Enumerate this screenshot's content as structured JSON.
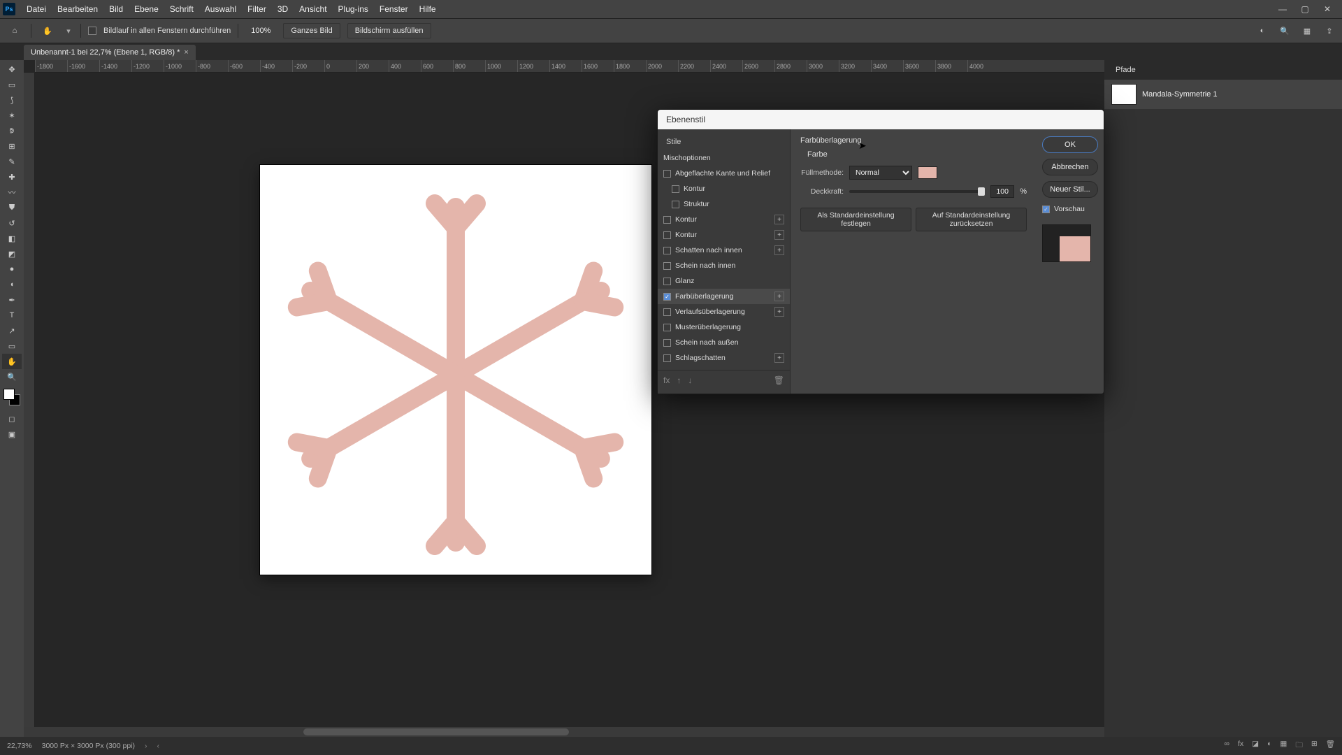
{
  "menu": {
    "items": [
      "Datei",
      "Bearbeiten",
      "Bild",
      "Ebene",
      "Schrift",
      "Auswahl",
      "Filter",
      "3D",
      "Ansicht",
      "Plug-ins",
      "Fenster",
      "Hilfe"
    ]
  },
  "opt": {
    "scrollcheck": "Bildlauf in allen Fenstern durchführen",
    "zoom": "100%",
    "fit": "Ganzes Bild",
    "fill": "Bildschirm ausfüllen"
  },
  "doc": {
    "tab": "Unbenannt-1 bei 22,7% (Ebene 1, RGB/8) *"
  },
  "ruler": {
    "marks": [
      "-1800",
      "-1600",
      "-1400",
      "-1200",
      "-1000",
      "-800",
      "-600",
      "-400",
      "-200",
      "0",
      "200",
      "400",
      "600",
      "800",
      "1000",
      "1200",
      "1400",
      "1600",
      "1800",
      "2000",
      "2200",
      "2400",
      "2600",
      "2800",
      "3000",
      "3200",
      "3400",
      "3600",
      "3800",
      "4000"
    ]
  },
  "paths": {
    "tab": "Pfade",
    "item": "Mandala-Symmetrie 1"
  },
  "dialog": {
    "title": "Ebenenstil",
    "stile": "Stile",
    "misch": "Mischoptionen",
    "effects": [
      {
        "label": "Abgeflachte Kante und Relief",
        "plus": false,
        "on": false,
        "sub": false
      },
      {
        "label": "Kontur",
        "plus": false,
        "on": false,
        "sub": true
      },
      {
        "label": "Struktur",
        "plus": false,
        "on": false,
        "sub": true
      },
      {
        "label": "Kontur",
        "plus": true,
        "on": false,
        "sub": false
      },
      {
        "label": "Kontur",
        "plus": true,
        "on": false,
        "sub": false
      },
      {
        "label": "Schatten nach innen",
        "plus": true,
        "on": false,
        "sub": false
      },
      {
        "label": "Schein nach innen",
        "plus": false,
        "on": false,
        "sub": false
      },
      {
        "label": "Glanz",
        "plus": false,
        "on": false,
        "sub": false
      },
      {
        "label": "Farbüberlagerung",
        "plus": true,
        "on": true,
        "sub": false,
        "sel": true
      },
      {
        "label": "Verlaufsüberlagerung",
        "plus": true,
        "on": false,
        "sub": false
      },
      {
        "label": "Musterüberlagerung",
        "plus": false,
        "on": false,
        "sub": false
      },
      {
        "label": "Schein nach außen",
        "plus": false,
        "on": false,
        "sub": false
      },
      {
        "label": "Schlagschatten",
        "plus": true,
        "on": false,
        "sub": false
      }
    ],
    "panel": {
      "heading": "Farbüberlagerung",
      "sub": "Farbe",
      "blend_lbl": "Füllmethode:",
      "blend_val": "Normal",
      "opac_lbl": "Deckkraft:",
      "opac_val": "100",
      "opac_unit": "%",
      "defbtn1": "Als Standardeinstellung festlegen",
      "defbtn2": "Auf Standardeinstellung zurücksetzen"
    },
    "btns": {
      "ok": "OK",
      "cancel": "Abbrechen",
      "new": "Neuer Stil...",
      "preview": "Vorschau"
    }
  },
  "status": {
    "zoom": "22,73%",
    "dim": "3000 Px × 3000 Px (300 ppi)"
  },
  "colors": {
    "overlay": "#e4b5ab"
  }
}
